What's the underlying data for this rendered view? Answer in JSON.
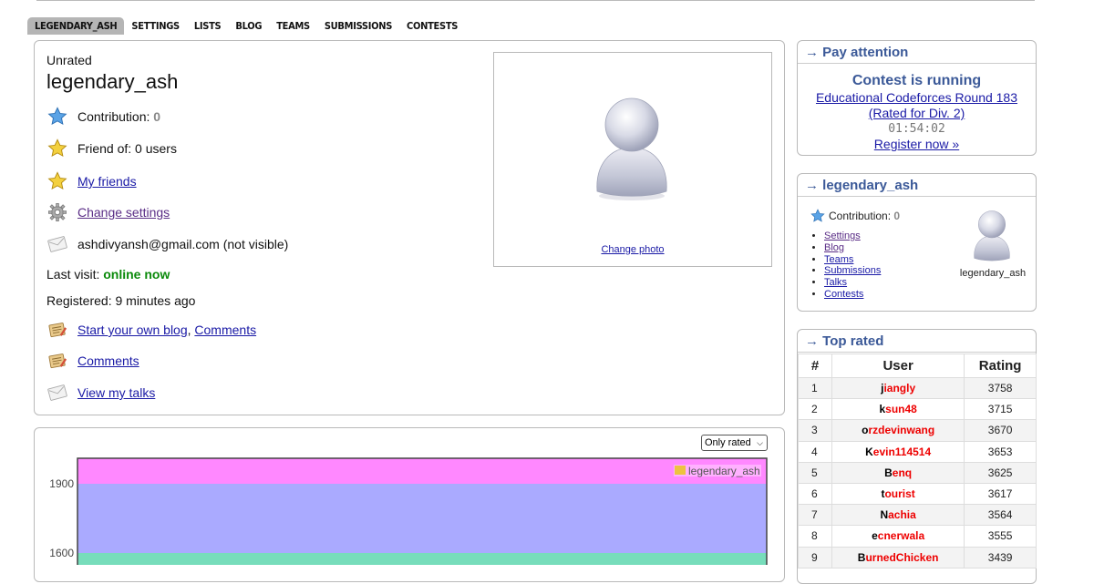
{
  "tabs": [
    "LEGENDARY_ASH",
    "SETTINGS",
    "LISTS",
    "BLOG",
    "TEAMS",
    "SUBMISSIONS",
    "CONTESTS"
  ],
  "profile": {
    "rank": "Unrated",
    "handle": "legendary_ash",
    "contribution_label": "Contribution:",
    "contribution_value": "0",
    "friend_of": "Friend of: 0 users",
    "my_friends": "My friends",
    "change_settings": "Change settings",
    "email": "ashdivyansh@gmail.com (not visible)",
    "last_visit_label": "Last visit:",
    "last_visit_value": "online now",
    "registered": "Registered: 9 minutes ago",
    "start_blog": "Start your own blog",
    "comma": ",",
    "comments1": "Comments",
    "comments2": "Comments",
    "view_talks": "View my talks",
    "change_photo": "Change photo"
  },
  "chart": {
    "filter_selected": "Only rated",
    "legend": "legendary_ash",
    "ticks": [
      "1900",
      "1600"
    ],
    "bands": [
      {
        "name": "top-band",
        "color": "#ff88ff"
      },
      {
        "name": "middle-band",
        "color": "#aaaaff"
      },
      {
        "name": "bottom-band",
        "color": "#77ddbb"
      }
    ]
  },
  "pay_attention": {
    "title": "→ Pay attention",
    "running": "Contest is running",
    "contest_line1": "Educational Codeforces Round 183",
    "contest_line2": "(Rated for Div. 2)",
    "timer": "01:54:02",
    "register": "Register now »"
  },
  "user_box": {
    "title": "→ legendary_ash",
    "contribution_label": "Contribution:",
    "contribution_value": "0",
    "links": [
      "Settings",
      "Blog",
      "Teams",
      "Submissions",
      "Talks",
      "Contests"
    ],
    "name": "legendary_ash"
  },
  "top_rated": {
    "title": "→ Top rated",
    "headers": [
      "#",
      "User",
      "Rating"
    ],
    "rows": [
      {
        "rank": "1",
        "first": "j",
        "rest": "iangly",
        "rating": "3758"
      },
      {
        "rank": "2",
        "first": "k",
        "rest": "sun48",
        "rating": "3715"
      },
      {
        "rank": "3",
        "first": "o",
        "rest": "rzdevinwang",
        "rating": "3670"
      },
      {
        "rank": "4",
        "first": "K",
        "rest": "evin114514",
        "rating": "3653"
      },
      {
        "rank": "5",
        "first": "B",
        "rest": "enq",
        "rating": "3625"
      },
      {
        "rank": "6",
        "first": "t",
        "rest": "ourist",
        "rating": "3617"
      },
      {
        "rank": "7",
        "first": "N",
        "rest": "achia",
        "rating": "3564"
      },
      {
        "rank": "8",
        "first": "e",
        "rest": "cnerwala",
        "rating": "3555"
      },
      {
        "rank": "9",
        "first": "B",
        "rest": "urnedChicken",
        "rating": "3439"
      }
    ]
  }
}
